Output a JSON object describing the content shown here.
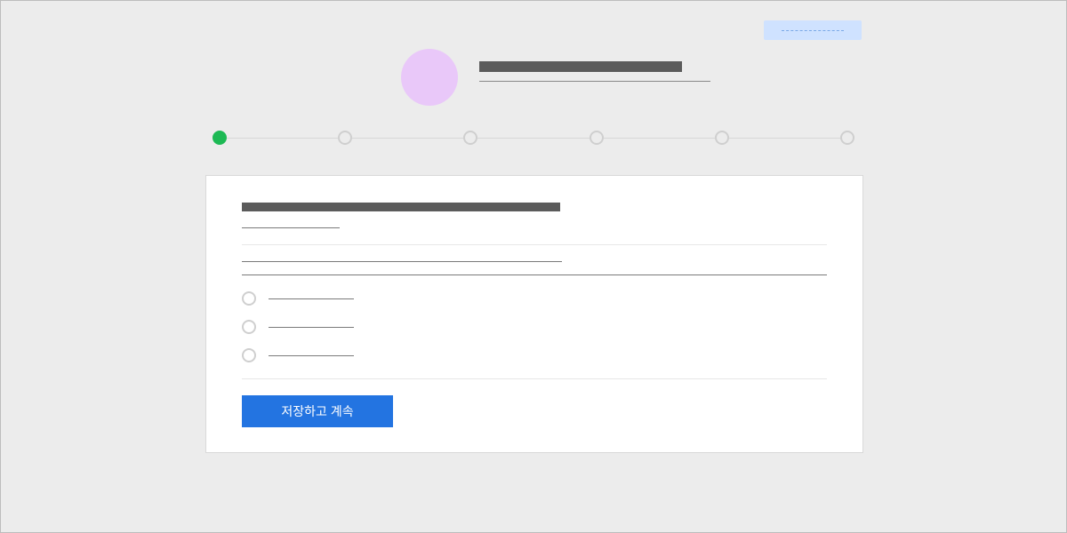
{
  "top_action": {
    "label": ""
  },
  "header": {
    "title": "",
    "subtitle": ""
  },
  "stepper": {
    "total_steps": 6,
    "active_index": 0
  },
  "card": {
    "section_title": "",
    "subtitle": "",
    "field": {
      "label": "",
      "value": ""
    },
    "options": [
      {
        "label": ""
      },
      {
        "label": ""
      },
      {
        "label": ""
      }
    ],
    "primary_button": "저장하고 계속"
  },
  "colors": {
    "accent_green": "#1db954",
    "primary_blue": "#2374e1",
    "avatar": "#e9c8f9",
    "pill": "#cfe2ff"
  }
}
